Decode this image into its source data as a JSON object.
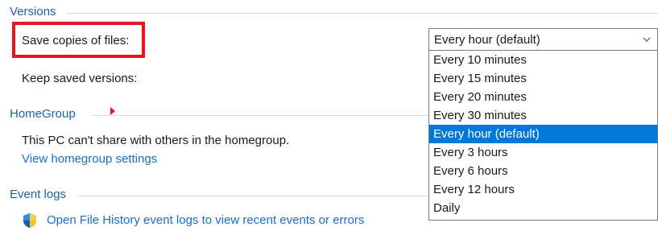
{
  "versions": {
    "header": "Versions",
    "save_copies_label": "Save copies of files:",
    "keep_versions_label": "Keep saved versions:",
    "save_frequency": {
      "selected": "Every hour (default)",
      "options": [
        "Every 10 minutes",
        "Every 15 minutes",
        "Every 20 minutes",
        "Every 30 minutes",
        "Every hour (default)",
        "Every 3 hours",
        "Every 6 hours",
        "Every 12 hours",
        "Daily"
      ],
      "highlighted_index": 4
    }
  },
  "homegroup": {
    "header": "HomeGroup",
    "status_text": "This PC can't share with others in the homegroup.",
    "settings_link": "View homegroup settings"
  },
  "event_logs": {
    "header": "Event logs",
    "link": "Open File History event logs to view recent events or errors",
    "icon": "security-shield-icon"
  },
  "colors": {
    "link": "#1a6fc4",
    "header": "#1f5fa8",
    "selection": "#0078d7",
    "annotation_red": "#e8141c"
  }
}
